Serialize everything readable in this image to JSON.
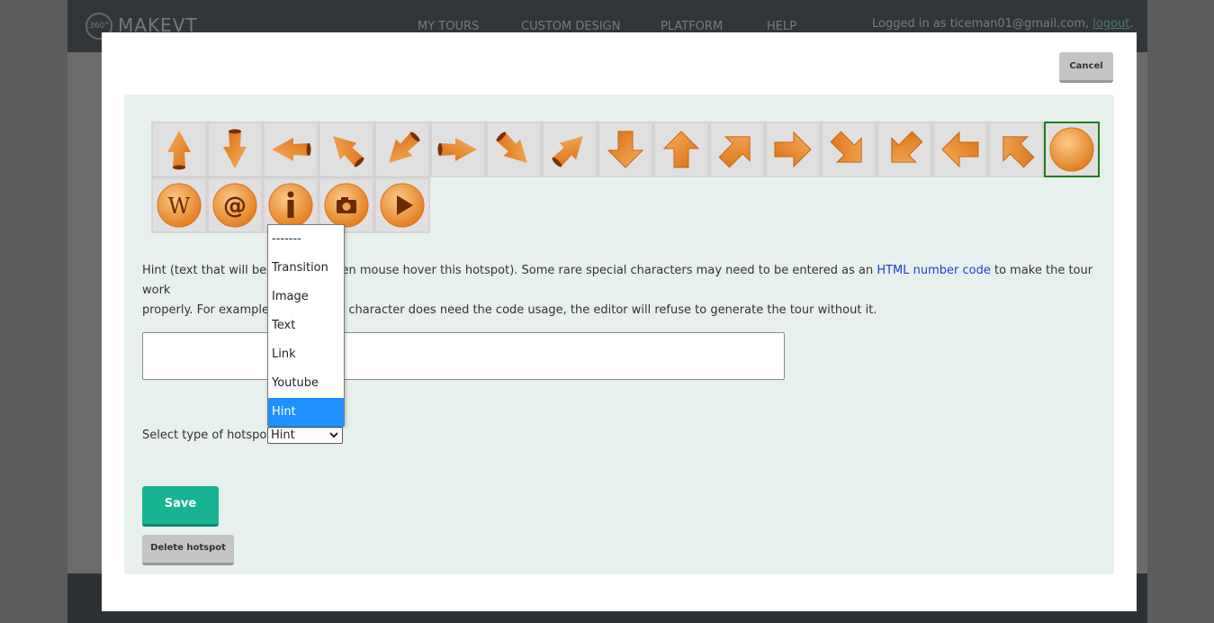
{
  "site": {
    "logo_badge": "360°",
    "logo_text": "MAKEVT",
    "nav": [
      "MY TOURS",
      "CUSTOM DESIGN",
      "PLATFORM",
      "HELP"
    ],
    "login_prefix": "Logged in as ticeman01@gmail.com, ",
    "logout_label": "logout",
    "login_suffix": "."
  },
  "modal": {
    "cancel_label": "Cancel",
    "icons": [
      "arrow-up-3d-icon",
      "arrow-down-3d-icon",
      "arrow-left-3d-icon",
      "arrow-upleft-3d-icon",
      "arrow-downleft-3d-icon",
      "arrow-right-3d-icon",
      "arrow-downright-3d-icon",
      "arrow-upright-3d-icon",
      "arrow-down-flat-icon",
      "arrow-up-flat-icon",
      "arrow-upright-flat-icon",
      "arrow-right-flat-icon",
      "arrow-downright-flat-icon",
      "arrow-downleft-flat-icon",
      "arrow-left-flat-icon",
      "arrow-upleft-flat-icon",
      "circle-icon",
      "wikipedia-icon",
      "email-icon",
      "info-icon",
      "camera-icon",
      "play-icon"
    ],
    "selected_icon": "circle-icon",
    "hint_part1": "Hint (text that will be sh",
    "hint_part2": "hen mouse hover this hotspot). Some rare special characters may need to be entered as an ",
    "hint_link": "HTML number code",
    "hint_part3": " to make the tour work",
    "hint_line2a": "properly. For example, ",
    "hint_line2b": "a character does need the code usage, the editor will refuse to generate the tour without it.",
    "hint_value": "",
    "select_label": "Select type of hotspot:",
    "select_value": "Hint",
    "dropdown_options": [
      "-------",
      "Transition",
      "Image",
      "Text",
      "Link",
      "Youtube",
      "Hint"
    ],
    "highlighted_option": "Hint",
    "save_label": "Save",
    "delete_label": "Delete hotspot"
  },
  "colors": {
    "accent": "#17b393",
    "panel": "#e8f0ee",
    "icon_orange": "#ef8f2c",
    "selected_border": "#1c7e1c",
    "dropdown_highlight": "#1e90ff"
  }
}
